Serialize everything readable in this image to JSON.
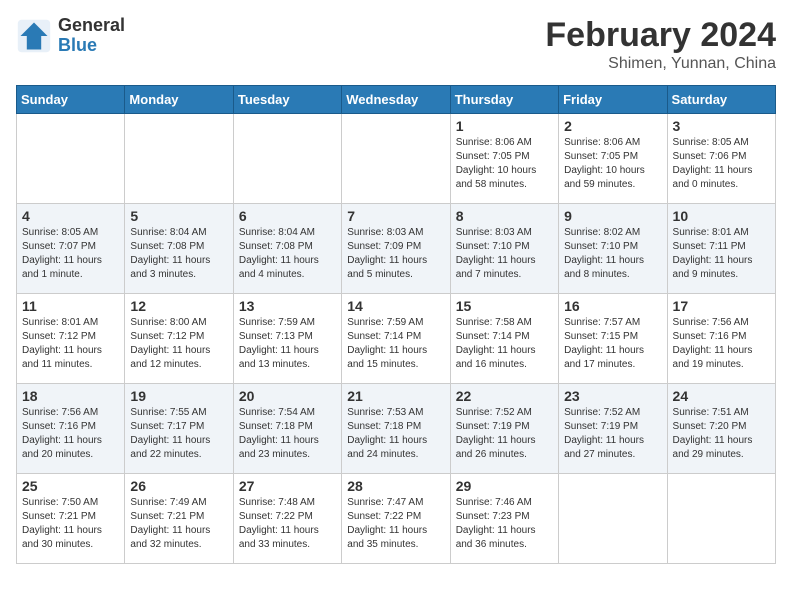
{
  "header": {
    "logo_general": "General",
    "logo_blue": "Blue",
    "month_year": "February 2024",
    "location": "Shimen, Yunnan, China"
  },
  "weekdays": [
    "Sunday",
    "Monday",
    "Tuesday",
    "Wednesday",
    "Thursday",
    "Friday",
    "Saturday"
  ],
  "weeks": [
    [
      {
        "day": "",
        "info": ""
      },
      {
        "day": "",
        "info": ""
      },
      {
        "day": "",
        "info": ""
      },
      {
        "day": "",
        "info": ""
      },
      {
        "day": "1",
        "info": "Sunrise: 8:06 AM\nSunset: 7:05 PM\nDaylight: 10 hours\nand 58 minutes."
      },
      {
        "day": "2",
        "info": "Sunrise: 8:06 AM\nSunset: 7:05 PM\nDaylight: 10 hours\nand 59 minutes."
      },
      {
        "day": "3",
        "info": "Sunrise: 8:05 AM\nSunset: 7:06 PM\nDaylight: 11 hours\nand 0 minutes."
      }
    ],
    [
      {
        "day": "4",
        "info": "Sunrise: 8:05 AM\nSunset: 7:07 PM\nDaylight: 11 hours\nand 1 minute."
      },
      {
        "day": "5",
        "info": "Sunrise: 8:04 AM\nSunset: 7:08 PM\nDaylight: 11 hours\nand 3 minutes."
      },
      {
        "day": "6",
        "info": "Sunrise: 8:04 AM\nSunset: 7:08 PM\nDaylight: 11 hours\nand 4 minutes."
      },
      {
        "day": "7",
        "info": "Sunrise: 8:03 AM\nSunset: 7:09 PM\nDaylight: 11 hours\nand 5 minutes."
      },
      {
        "day": "8",
        "info": "Sunrise: 8:03 AM\nSunset: 7:10 PM\nDaylight: 11 hours\nand 7 minutes."
      },
      {
        "day": "9",
        "info": "Sunrise: 8:02 AM\nSunset: 7:10 PM\nDaylight: 11 hours\nand 8 minutes."
      },
      {
        "day": "10",
        "info": "Sunrise: 8:01 AM\nSunset: 7:11 PM\nDaylight: 11 hours\nand 9 minutes."
      }
    ],
    [
      {
        "day": "11",
        "info": "Sunrise: 8:01 AM\nSunset: 7:12 PM\nDaylight: 11 hours\nand 11 minutes."
      },
      {
        "day": "12",
        "info": "Sunrise: 8:00 AM\nSunset: 7:12 PM\nDaylight: 11 hours\nand 12 minutes."
      },
      {
        "day": "13",
        "info": "Sunrise: 7:59 AM\nSunset: 7:13 PM\nDaylight: 11 hours\nand 13 minutes."
      },
      {
        "day": "14",
        "info": "Sunrise: 7:59 AM\nSunset: 7:14 PM\nDaylight: 11 hours\nand 15 minutes."
      },
      {
        "day": "15",
        "info": "Sunrise: 7:58 AM\nSunset: 7:14 PM\nDaylight: 11 hours\nand 16 minutes."
      },
      {
        "day": "16",
        "info": "Sunrise: 7:57 AM\nSunset: 7:15 PM\nDaylight: 11 hours\nand 17 minutes."
      },
      {
        "day": "17",
        "info": "Sunrise: 7:56 AM\nSunset: 7:16 PM\nDaylight: 11 hours\nand 19 minutes."
      }
    ],
    [
      {
        "day": "18",
        "info": "Sunrise: 7:56 AM\nSunset: 7:16 PM\nDaylight: 11 hours\nand 20 minutes."
      },
      {
        "day": "19",
        "info": "Sunrise: 7:55 AM\nSunset: 7:17 PM\nDaylight: 11 hours\nand 22 minutes."
      },
      {
        "day": "20",
        "info": "Sunrise: 7:54 AM\nSunset: 7:18 PM\nDaylight: 11 hours\nand 23 minutes."
      },
      {
        "day": "21",
        "info": "Sunrise: 7:53 AM\nSunset: 7:18 PM\nDaylight: 11 hours\nand 24 minutes."
      },
      {
        "day": "22",
        "info": "Sunrise: 7:52 AM\nSunset: 7:19 PM\nDaylight: 11 hours\nand 26 minutes."
      },
      {
        "day": "23",
        "info": "Sunrise: 7:52 AM\nSunset: 7:19 PM\nDaylight: 11 hours\nand 27 minutes."
      },
      {
        "day": "24",
        "info": "Sunrise: 7:51 AM\nSunset: 7:20 PM\nDaylight: 11 hours\nand 29 minutes."
      }
    ],
    [
      {
        "day": "25",
        "info": "Sunrise: 7:50 AM\nSunset: 7:21 PM\nDaylight: 11 hours\nand 30 minutes."
      },
      {
        "day": "26",
        "info": "Sunrise: 7:49 AM\nSunset: 7:21 PM\nDaylight: 11 hours\nand 32 minutes."
      },
      {
        "day": "27",
        "info": "Sunrise: 7:48 AM\nSunset: 7:22 PM\nDaylight: 11 hours\nand 33 minutes."
      },
      {
        "day": "28",
        "info": "Sunrise: 7:47 AM\nSunset: 7:22 PM\nDaylight: 11 hours\nand 35 minutes."
      },
      {
        "day": "29",
        "info": "Sunrise: 7:46 AM\nSunset: 7:23 PM\nDaylight: 11 hours\nand 36 minutes."
      },
      {
        "day": "",
        "info": ""
      },
      {
        "day": "",
        "info": ""
      }
    ]
  ]
}
